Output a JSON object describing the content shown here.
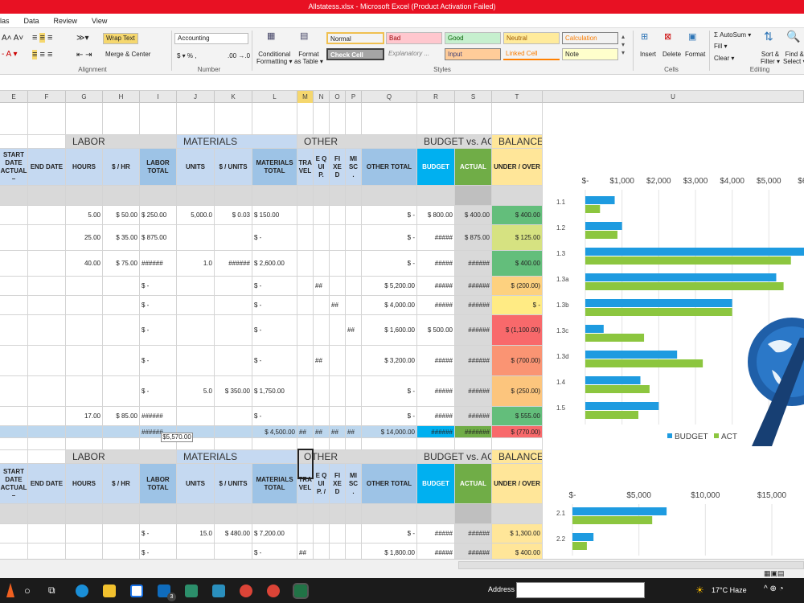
{
  "window": {
    "title": "Allstatess.xlsx - Microsoft Excel (Product Activation Failed)"
  },
  "menu": [
    "las",
    "Data",
    "Review",
    "View"
  ],
  "ribbon": {
    "wrap_text": "Wrap Text",
    "merge_center": "Merge & Center",
    "alignment_label": "Alignment",
    "number_format": "Accounting",
    "number_symbols": "$ ▾ %  ,",
    "number_dec": ".00 →.0",
    "number_label": "Number",
    "conditional": "Conditional",
    "conditional2": "Formatting ▾",
    "format_as": "Format",
    "format_as2": "as Table ▾",
    "styles": [
      {
        "label": "Normal",
        "bg": "#ffffff",
        "fg": "#000000"
      },
      {
        "label": "Bad",
        "bg": "#ffc7ce",
        "fg": "#9c0006"
      },
      {
        "label": "Good",
        "bg": "#c6efce",
        "fg": "#006100"
      },
      {
        "label": "Neutral",
        "bg": "#ffeb9c",
        "fg": "#9c5700"
      },
      {
        "label": "Calculation",
        "bg": "#f2f2f2",
        "fg": "#fa7d00"
      },
      {
        "label": "Check Cell",
        "bg": "#a5a5a5",
        "fg": "#ffffff"
      },
      {
        "label": "Explanatory ...",
        "bg": "#ffffff",
        "fg": "#7f7f7f"
      },
      {
        "label": "Input",
        "bg": "#ffcc99",
        "fg": "#3f3f76"
      },
      {
        "label": "Linked Cell",
        "bg": "#ffffff",
        "fg": "#fa7d00"
      },
      {
        "label": "Note",
        "bg": "#ffffcc",
        "fg": "#000000"
      }
    ],
    "styles_label": "Styles",
    "insert": "Insert",
    "delete": "Delete",
    "format": "Format",
    "cells_label": "Cells",
    "autosum": "Σ AutoSum ▾",
    "fill": "Fill ▾",
    "clear": "Clear ▾",
    "sort": "Sort &",
    "sort2": "Filter ▾",
    "find": "Find &",
    "find2": "Select ▾",
    "editing_label": "Editing"
  },
  "columns": [
    "E",
    "F",
    "G",
    "H",
    "I",
    "J",
    "K",
    "L",
    "M",
    "N",
    "O",
    "P",
    "Q",
    "R",
    "S",
    "T",
    "U"
  ],
  "sections": {
    "labor": "LABOR",
    "materials": "MATERIALS",
    "other": "OTHER",
    "budget": "BUDGET vs. ACT",
    "balance": "BALANCE"
  },
  "headers": {
    "start": "START DATE ACTUAL –",
    "end": "END DATE",
    "hours": "HOURS",
    "rate": "$ / HR",
    "labor_total": "LABOR TOTAL",
    "units": "UNITS",
    "per_unit": "$ / UNITS",
    "mat_total": "MATERIALS TOTAL",
    "travel": "TRA VEL",
    "equip": "E Q UI P.",
    "fixed": "FI XE D",
    "misc": "MI SC .",
    "other_total": "OTHER TOTAL",
    "budget": "BUDGET",
    "actual": "ACTUAL",
    "under_over": "UNDER / OVER"
  },
  "headers2": {
    "equip": "E Q UI P. /"
  },
  "rows1": [
    {
      "hours": "5.00",
      "rate": "$ 50.00",
      "labor": "$ 250.00",
      "units": "5,000.0",
      "per_unit": "$ 0.03",
      "mat": "$ 150.00",
      "travel": "",
      "equip": "",
      "fixed": "",
      "misc": "",
      "other": "$ -",
      "budget": "$ 800.00",
      "actual": "$ 400.00",
      "bal": "$ 400.00",
      "balbg": "#63be7b"
    },
    {
      "hours": "25.00",
      "rate": "$ 35.00",
      "labor": "$ 875.00",
      "units": "",
      "per_unit": "",
      "mat": "$ -",
      "travel": "",
      "equip": "",
      "fixed": "",
      "misc": "",
      "other": "$ -",
      "budget": "#####",
      "actual": "$ 875.00",
      "bal": "$ 125.00",
      "balbg": "#d6e281"
    },
    {
      "hours": "40.00",
      "rate": "$ 75.00",
      "labor": "######",
      "units": "1.0",
      "per_unit": "######",
      "mat": "$ 2,600.00",
      "travel": "",
      "equip": "",
      "fixed": "",
      "misc": "",
      "other": "$ -",
      "budget": "#####",
      "actual": "######",
      "bal": "$ 400.00",
      "balbg": "#63be7b"
    },
    {
      "hours": "",
      "rate": "",
      "labor": "$ -",
      "units": "",
      "per_unit": "",
      "mat": "$ -",
      "travel": "",
      "equip": "##",
      "fixed": "",
      "misc": "",
      "other": "$ 5,200.00",
      "budget": "#####",
      "actual": "######",
      "bal": "$ (200.00)",
      "balbg": "#fdd17f"
    },
    {
      "hours": "",
      "rate": "",
      "labor": "$ -",
      "units": "",
      "per_unit": "",
      "mat": "$ -",
      "travel": "",
      "equip": "",
      "fixed": "##",
      "misc": "",
      "other": "$ 4,000.00",
      "budget": "#####",
      "actual": "######",
      "bal": "$ -",
      "balbg": "#ffeb84"
    },
    {
      "hours": "",
      "rate": "",
      "labor": "$ -",
      "units": "",
      "per_unit": "",
      "mat": "$ -",
      "travel": "",
      "equip": "",
      "fixed": "",
      "misc": "##",
      "other": "$ 1,600.00",
      "budget": "$ 500.00",
      "actual": "######",
      "bal": "$ (1,100.00)",
      "balbg": "#f8696b"
    },
    {
      "hours": "",
      "rate": "",
      "labor": "$ -",
      "units": "",
      "per_unit": "",
      "mat": "$ -",
      "travel": "",
      "equip": "##",
      "fixed": "",
      "misc": "",
      "other": "$ 3,200.00",
      "budget": "#####",
      "actual": "######",
      "bal": "$ (700.00)",
      "balbg": "#fa9473"
    },
    {
      "hours": "",
      "rate": "",
      "labor": "$ -",
      "units": "5.0",
      "per_unit": "$ 350.00",
      "mat": "$ 1,750.00",
      "travel": "",
      "equip": "",
      "fixed": "",
      "misc": "",
      "other": "$ -",
      "budget": "#####",
      "actual": "######",
      "bal": "$ (250.00)",
      "balbg": "#fcc57d"
    },
    {
      "hours": "17.00",
      "rate": "$ 85.00",
      "labor": "######",
      "units": "",
      "per_unit": "",
      "mat": "$ -",
      "travel": "",
      "equip": "",
      "fixed": "",
      "misc": "",
      "other": "$ -",
      "budget": "#####",
      "actual": "######",
      "bal": "$ 555.00",
      "balbg": "#63be7b"
    }
  ],
  "total1": {
    "labor": "######",
    "mat": "$ 4,500.00",
    "travel": "##",
    "equip": "##",
    "fixed": "##",
    "misc": "##",
    "other": "$ 14,000.00",
    "budget": "######",
    "actual": "#######",
    "bal": "$ (770.00)"
  },
  "tooltip": "$5,570.00",
  "rows2": [
    {
      "labor": "$ -",
      "units": "15.0",
      "per_unit": "$ 480.00",
      "mat": "$ 7,200.00",
      "travel": "",
      "other": "$ -",
      "budget": "#####",
      "actual": "######",
      "bal": "$ 1,300.00"
    },
    {
      "labor": "$ -",
      "units": "",
      "per_unit": "",
      "mat": "$ -",
      "travel": "##",
      "other": "$ 1,800.00",
      "budget": "#####",
      "actual": "######",
      "bal": "$ 400.00"
    }
  ],
  "chart_data": [
    {
      "type": "bar",
      "orientation": "horizontal",
      "categories": [
        "1.1",
        "1.2",
        "1.3",
        "1.3a",
        "1.3b",
        "1.3c",
        "1.3d",
        "1.4",
        "1.5"
      ],
      "x_ticks": [
        "$-",
        "$1,000",
        "$2,000",
        "$3,000",
        "$4,000",
        "$5,000",
        "$6,0"
      ],
      "xlim": [
        0,
        6000
      ],
      "series": [
        {
          "name": "BUDGET",
          "color": "#1e9be0",
          "values": [
            800,
            1000,
            6000,
            5200,
            4000,
            500,
            2500,
            1500,
            2000
          ]
        },
        {
          "name": "ACT",
          "color": "#8cc63f",
          "values": [
            400,
            875,
            5600,
            5400,
            4000,
            1600,
            3200,
            1750,
            1445
          ]
        }
      ],
      "legend": "bottom"
    },
    {
      "type": "bar",
      "orientation": "horizontal",
      "categories": [
        "2.1",
        "2.2"
      ],
      "x_ticks": [
        "$-",
        "$5,000",
        "$10,000",
        "$15,000"
      ],
      "xlim": [
        0,
        18000
      ],
      "series": [
        {
          "name": "BUDGET",
          "color": "#1e9be0",
          "values": [
            8500,
            1900
          ]
        },
        {
          "name": "ACT",
          "color": "#8cc63f",
          "values": [
            7200,
            1300
          ]
        }
      ]
    }
  ],
  "taskbar": {
    "address": "Address",
    "weather": "17°C Haze",
    "badge": "3"
  }
}
